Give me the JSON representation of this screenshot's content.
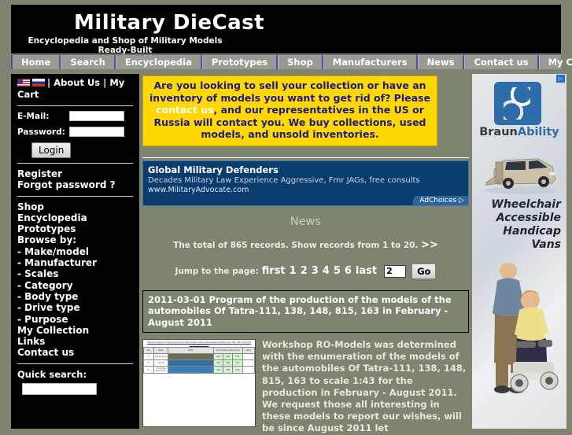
{
  "site": {
    "title": "Military DieCast",
    "tagline": "Encyclopedia and Shop of Military Models Ready-Built",
    "tagline_line1": "Encyclopedia and Shop of Military Models",
    "tagline_line2": "Ready-Built"
  },
  "nav": {
    "items": [
      {
        "label": "Home"
      },
      {
        "label": "Search"
      },
      {
        "label": "Encyclopedia"
      },
      {
        "label": "Prototypes"
      },
      {
        "label": "Shop"
      },
      {
        "label": "Manufacturers"
      },
      {
        "label": "News"
      },
      {
        "label": "Contact us"
      },
      {
        "label": "My Cart"
      }
    ]
  },
  "sidebar": {
    "lang": {
      "us_flag": "us-flag-icon",
      "ru_flag": "ru-flag-icon",
      "sep1": "|",
      "about_us": "About Us",
      "sep2": "|",
      "my_cart": "My Cart"
    },
    "login": {
      "email_label": "E-Mail:",
      "email_value": "",
      "password_label": "Password:",
      "password_value": "",
      "login_button": "Login"
    },
    "account_links": [
      {
        "label": "Register"
      },
      {
        "label": "Forgot password ?"
      }
    ],
    "menu": [
      {
        "label": "Shop",
        "link": true
      },
      {
        "label": "Encyclopedia",
        "link": true
      },
      {
        "label": "Prototypes",
        "link": true
      },
      {
        "label": "Browse by:",
        "link": false
      },
      {
        "label": "- Make/model",
        "link": true
      },
      {
        "label": "- Manufacturer",
        "link": true
      },
      {
        "label": "- Scales",
        "link": true
      },
      {
        "label": "- Category",
        "link": true
      },
      {
        "label": "- Body type",
        "link": true
      },
      {
        "label": "- Drive type",
        "link": true
      },
      {
        "label": "- Purpose",
        "link": true
      },
      {
        "label": "My Collection",
        "link": true
      },
      {
        "label": "Links",
        "link": true
      },
      {
        "label": "Contact us",
        "link": true
      }
    ],
    "quick_search": {
      "label": "Quick search:",
      "value": "",
      "placeholder": ""
    }
  },
  "yellow_ad": {
    "part1": "Are you looking to sell your collection or have an inventory of models you want to get rid of? Please ",
    "link": "contact us",
    "part2": ", and our representatives in the US or Russia will contact you. We buy collections, used models, and unsold inventories."
  },
  "blue_ad": {
    "title": "Global Military Defenders",
    "description": "Decades Military Law Experience Aggressive, Fmr JAGs, free consults",
    "url": "www.MilitaryAdvocate.com",
    "adchoices": "AdChoices"
  },
  "news": {
    "heading": "News",
    "records_text": "The total of 865 records. Show records from 1 to 20.",
    "next_arrow": ">>",
    "total_records": 865,
    "range_from": 1,
    "range_to": 20,
    "jump_label": "Jump to the page:",
    "first_label": "first",
    "pages": [
      "1",
      "2",
      "3",
      "4",
      "5",
      "6"
    ],
    "last_label": "last",
    "page_input_value": "2",
    "go_button": "Go",
    "article": {
      "title": "2011-03-01 Program of the production of the models of the automobiles Of Tatra-111, 138, 148, 815, 163 in February - August 2011",
      "body": "Workshop RO-Models was determined with the enumeration of the models of the automobiles Of Tatra-111, 138, 148, 815, 163 to scale 1:43 for the production in February - August 2011. We request those all interesting in these models to report our wishes, will be since August 2011 let",
      "thumb_caption": "Current program of the production of the models of the automobiles Of Tatra-111, 138, 148, 815, 163 in first half of 2011",
      "thumb_headers": [
        "No",
        "Mark",
        "Photo",
        "Price of the model (US $)",
        "Note"
      ],
      "thumb_rows": [
        {
          "no": "1.",
          "mark": "113-s2 army",
          "prices": [
            "130",
            "150",
            "175"
          ]
        },
        {
          "no": "2.",
          "mark": "113-s3",
          "prices": [
            "130",
            "150",
            "175"
          ]
        },
        {
          "no": "3.",
          "mark": "113-s3 No blok board",
          "prices": [
            "130",
            "150",
            "175"
          ]
        }
      ]
    }
  },
  "right_ad": {
    "brand_part1": "Braun",
    "brand_part2": "Ability",
    "tagline_lines": [
      "Wheelchair",
      "Accessible",
      "Handicap",
      "Vans"
    ],
    "adchoices_icon": "adchoices-triangle-icon"
  },
  "colors": {
    "page_background": "#7d8470",
    "header_background": "#000000",
    "nav_background": "#9a9a95",
    "nav_separator": "#5a49a8",
    "yellow_ad_bg": "#ffd800",
    "yellow_ad_text": "#1b1b8f",
    "blue_ad_bg": "#0b3c6e",
    "brand_blue": "#2f6daa"
  }
}
